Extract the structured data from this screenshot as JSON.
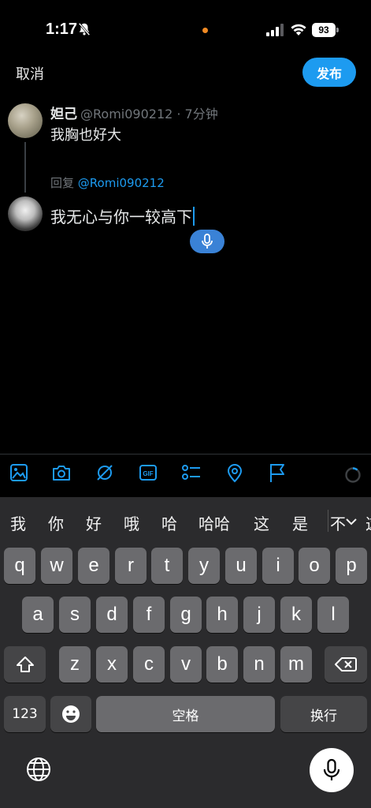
{
  "status_bar": {
    "time": "1:17",
    "battery": "93",
    "icons": [
      "bell-muted-icon",
      "signal-icon",
      "wifi-icon",
      "battery-icon"
    ]
  },
  "top_bar": {
    "cancel_label": "取消",
    "publish_label": "发布"
  },
  "original_tweet": {
    "name": "妲己",
    "handle_time": "@Romi090212 · 7分钟",
    "text": "我胸也好大"
  },
  "reply": {
    "reply_prefix": "回复",
    "reply_handle": "@Romi090212",
    "compose_text": "我无心与你一较高下"
  },
  "toolbar": {
    "icons": [
      "image-icon",
      "camera-icon",
      "grok-icon",
      "gif-icon",
      "poll-icon",
      "location-icon",
      "flag-icon",
      "progress-ring-icon"
    ]
  },
  "keyboard": {
    "candidates": [
      "我",
      "你",
      "好",
      "哦",
      "哈",
      "哈哈",
      "这",
      "是",
      "不",
      "这"
    ],
    "row1": [
      "q",
      "w",
      "e",
      "r",
      "t",
      "y",
      "u",
      "i",
      "o",
      "p"
    ],
    "row2": [
      "a",
      "s",
      "d",
      "f",
      "g",
      "h",
      "j",
      "k",
      "l"
    ],
    "row3": [
      "z",
      "x",
      "c",
      "v",
      "b",
      "n",
      "m"
    ],
    "numbers_label": "123",
    "space_label": "空格",
    "return_label": "换行"
  },
  "colors": {
    "accent": "#1d9bf0",
    "background": "#000000",
    "keyboard_bg": "#2b2b2d",
    "key": "#6b6b6e"
  }
}
